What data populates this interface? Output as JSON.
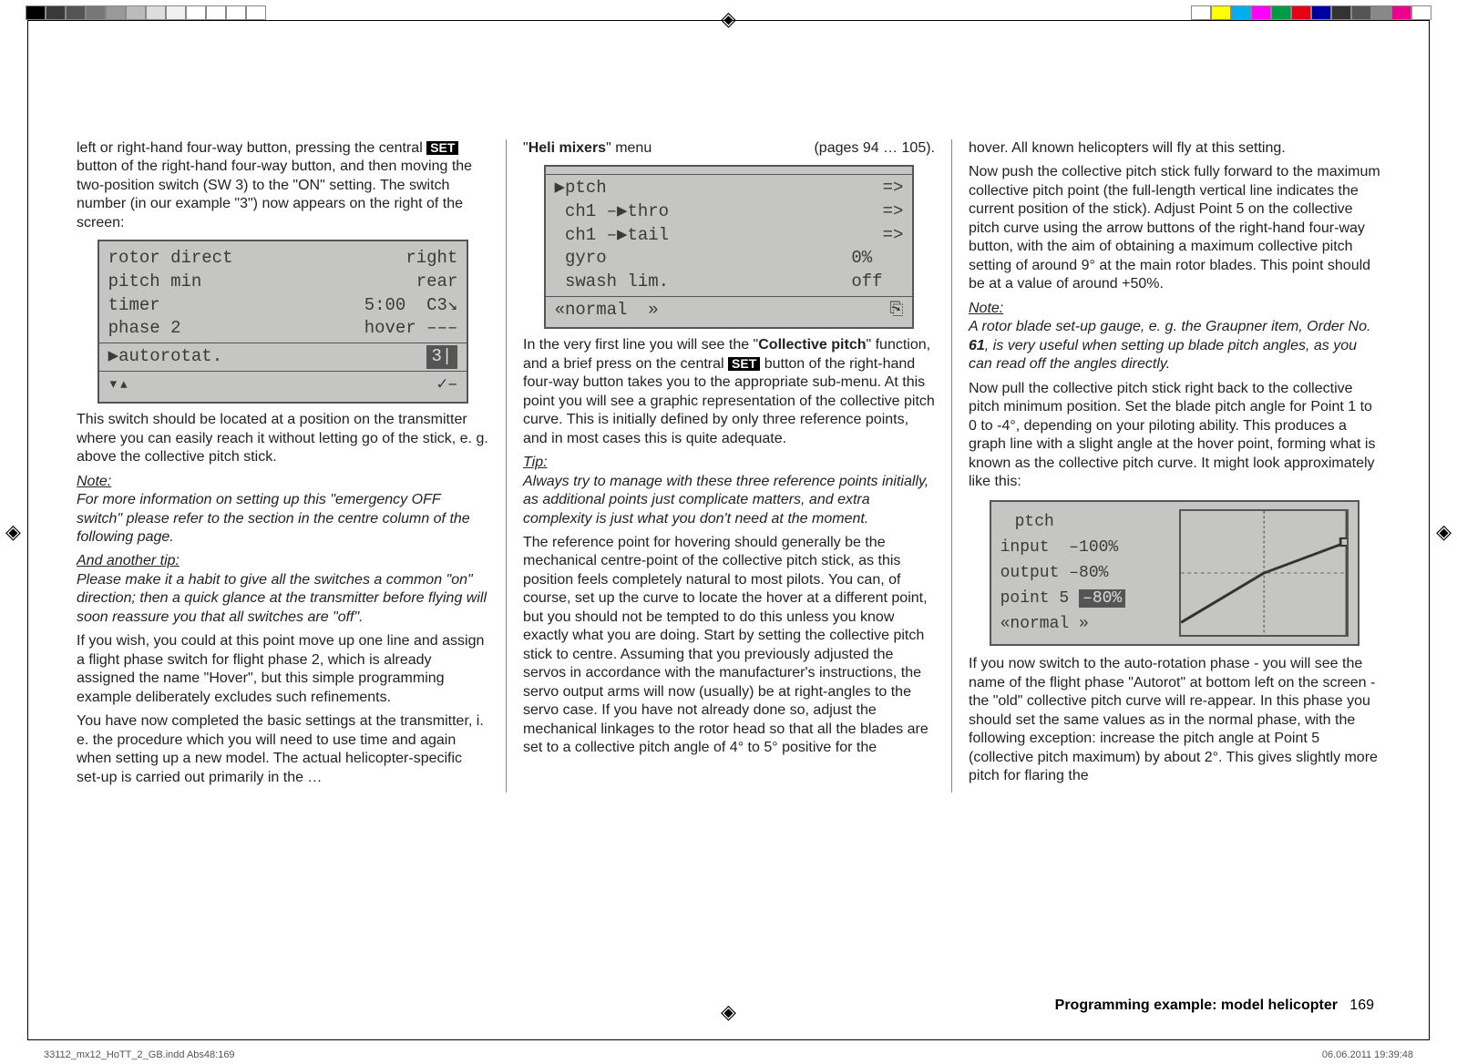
{
  "colorbars": {
    "left": [
      "#000000",
      "#3a3a3a",
      "#555555",
      "#777777",
      "#999999",
      "#bbbbbb",
      "#dddddd",
      "#f0f0f0",
      "#ffffff",
      "#ffffff",
      "#ffffff",
      "#ffffff"
    ],
    "right": [
      "#ffffff",
      "#ffff00",
      "#00aeef",
      "#ff00ff",
      "#009944",
      "#e60012",
      "#0000a0",
      "#333333",
      "#555555",
      "#888888",
      "#ec008c",
      "#ffffff"
    ]
  },
  "col1": {
    "intro_before_set": "left or right-hand four-way button, pressing the central ",
    "set_label": "SET",
    "intro_after_set": " button of the right-hand four-way button, and then moving the two-position switch (SW 3) to the \"ON\" setting. The switch number (in our example \"3\") now appears on the right of the screen:",
    "lcd1": {
      "rows": [
        {
          "l": "rotor direct",
          "r": "right"
        },
        {
          "l": "pitch min",
          "r": "rear"
        },
        {
          "l": "timer",
          "r": "5:00  C3↘"
        },
        {
          "l": "phase 2",
          "r": "hover –––"
        }
      ],
      "autorot_label": "▶autorotat.",
      "autorot_box": "3|",
      "bottom_left": "▾▴",
      "bottom_right": "✓–"
    },
    "p2": "This switch should be located at a position on the transmitter where you can easily reach it without letting go of the stick, e. g. above the collective pitch stick.",
    "note_head": "Note:",
    "note_body": "For more information on setting up this \"emergency OFF switch\" please refer to the section in the centre column of the following page.",
    "tip_head": "And another tip:",
    "tip_body": "Please make it a habit to give all the switches a common \"on\" direction; then a quick glance at the transmitter before flying will soon reassure you that all switches are \"off\".",
    "p3": "If you wish, you could at this point move up one line and assign a flight phase switch for flight phase 2, which is already assigned the name \"Hover\", but this simple programming example deliberately excludes such refinements.",
    "p4": "You have now completed the basic settings at the transmitter, i. e. the procedure which you will need to use time and again when setting up a new model. The actual helicopter-specific set-up is carried out primarily in the …"
  },
  "col2": {
    "menu_title_prefix": "\"",
    "menu_title_bold": "Heli mixers",
    "menu_title_suffix": "\" menu",
    "menu_pages": "(pages 94 … 105).",
    "lcd2": {
      "rows": [
        {
          "l": "▶ptch",
          "r": "=>"
        },
        {
          "l": " ch1 –▶thro",
          "r": "=>"
        },
        {
          "l": " ch1 –▶tail",
          "r": "=>"
        },
        {
          "l": " gyro",
          "r": "0%   "
        },
        {
          "l": " swash lim.",
          "r": "off  "
        }
      ],
      "bottom_left": "«normal  »",
      "bottom_right": "⎘"
    },
    "p1_before_bold": "In the very first line you will see the \"",
    "p1_bold": "Collective pitch",
    "p1_mid": "\" function, and a brief press on the central ",
    "p1_set": "SET",
    "p1_after": " button of the right-hand four-way button takes you to the appropriate sub-menu. At this point you will see a graphic representation of the collective pitch curve. This is initially defined by only three reference points, and in most cases this is quite adequate.",
    "tip_head": "Tip:",
    "tip_body": "Always try to manage with these three reference points initially, as additional points just complicate matters, and extra complexity is just what you don't need at the moment.",
    "p2": "The reference point for hovering should generally be the mechanical centre-point of the collective pitch stick, as this position feels completely natural to most pilots. You can, of course, set up the curve to locate the hover at a different point, but you should not be tempted to do this unless you know exactly what you are doing. Start by setting the collective pitch stick to centre. Assuming that you previously adjusted the servos in accordance with the manufacturer's instructions, the servo output arms will now (usually) be at right-angles to the servo case. If you have not already done so, adjust the mechanical linkages to the rotor head so that all the blades are set to a collective pitch angle of 4° to 5° positive for the"
  },
  "col3": {
    "p1": "hover. All known helicopters will fly at this setting.",
    "p2": "Now push the collective pitch stick fully forward to the maximum collective pitch point (the full-length vertical line indicates the current position of the stick). Adjust Point 5 on the collective pitch curve using the arrow buttons of the right-hand four-way button, with the aim of obtaining a maximum collective pitch setting of around 9° at the main rotor blades. This point should be at a value of around +50%.",
    "note_head": "Note:",
    "note_body_before_bold": "A rotor blade set-up gauge, e. g. the Graupner item, Order No. ",
    "note_body_bold": "61",
    "note_body_after_bold": ", is very useful when setting up blade pitch angles, as you can read off the angles directly.",
    "p3": "Now pull the collective pitch stick right back to the collective pitch minimum position. Set the blade pitch angle for Point 1 to 0 to -4°, depending on your piloting ability. This produces a graph line with a slight angle at the hover point, forming what is known as the collective pitch curve. It might look approximately like this:",
    "graph": {
      "title": "ptch",
      "input_label": "input",
      "input_val": "–100%",
      "output_label": "output",
      "output_val": "–80%",
      "point_label": "point  5",
      "point_val": "–80%",
      "bottom": "«normal  »"
    },
    "p4": "If you now switch to the auto-rotation phase - you will see the name of the flight phase \"Autorot\" at bottom left on the screen - the \"old\" collective pitch curve will re-appear. In this phase you should set the same values as in the normal phase, with the following exception: increase the pitch angle at Point 5 (collective pitch maximum) by about 2°. This gives slightly more pitch for flaring the"
  },
  "chart_data": {
    "type": "line",
    "title": "ptch",
    "x": [
      1,
      3,
      5
    ],
    "values": [
      -80,
      0,
      50
    ],
    "xlabel": "point",
    "ylabel": "output %",
    "ylim": [
      -100,
      100
    ],
    "annotations": {
      "input": "-100%",
      "output": "-80%",
      "current_point": 5,
      "mode": "normal"
    }
  },
  "footer": {
    "section_bold": "Programming example: model helicopter",
    "page_num": "169"
  },
  "outside": {
    "left": "33112_mx12_HoTT_2_GB.indd   Abs48:169",
    "right": "06.06.2011   19:39:48"
  }
}
